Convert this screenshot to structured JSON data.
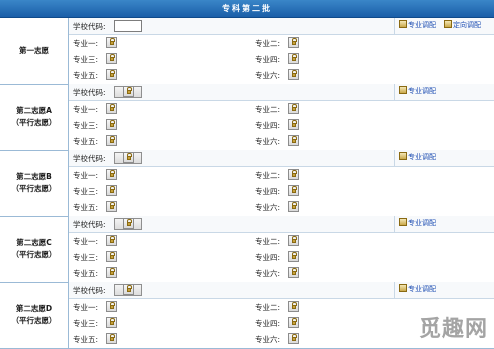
{
  "header": {
    "title": "专科第二批"
  },
  "labels": {
    "school_code": "学校代码:",
    "major_adjust": "专业调配",
    "directed_adjust": "定向调配",
    "majors": [
      "专业一:",
      "专业二:",
      "专业三:",
      "专业四:",
      "专业五:",
      "专业六:"
    ]
  },
  "blocks": [
    {
      "name": "第一志愿",
      "sub": "",
      "code_editable": true
    },
    {
      "name": "第二志愿A",
      "sub": "（平行志愿）",
      "code_editable": false
    },
    {
      "name": "第二志愿B",
      "sub": "（平行志愿）",
      "code_editable": false
    },
    {
      "name": "第二志愿C",
      "sub": "（平行志愿）",
      "code_editable": false
    },
    {
      "name": "第二志愿D",
      "sub": "（平行志愿）",
      "code_editable": false
    }
  ],
  "watermark": "觅趣网"
}
